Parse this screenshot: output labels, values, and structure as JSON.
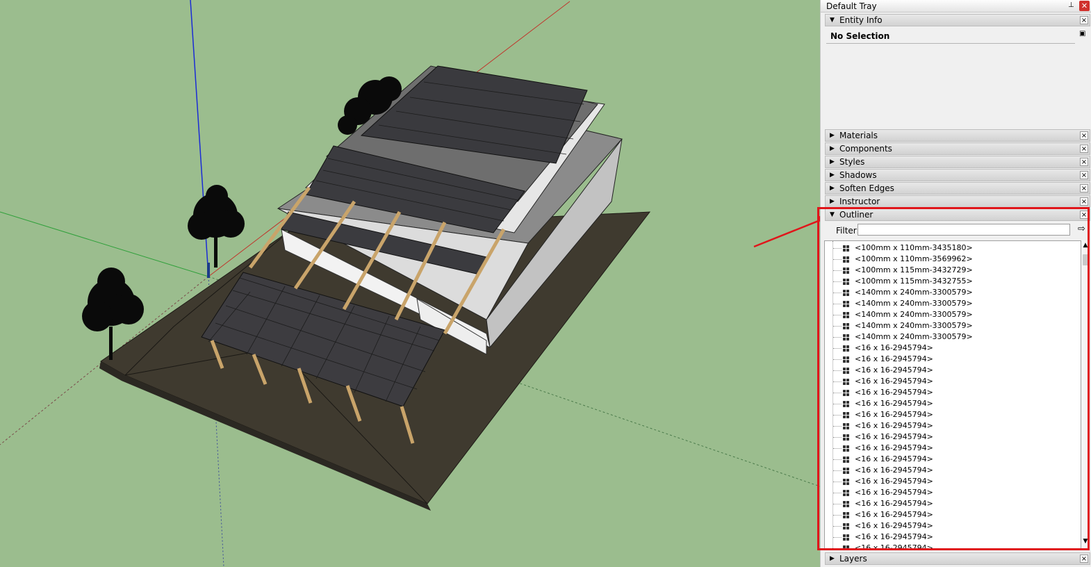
{
  "tray": {
    "title": "Default Tray",
    "close": "✕",
    "pin": "⊥"
  },
  "entity_info": {
    "label": "Entity Info",
    "status": "No Selection"
  },
  "panels": [
    {
      "label": "Materials"
    },
    {
      "label": "Components"
    },
    {
      "label": "Styles"
    },
    {
      "label": "Shadows"
    },
    {
      "label": "Soften Edges"
    },
    {
      "label": "Instructor"
    }
  ],
  "outliner": {
    "label": "Outliner",
    "filter_label": "Filter:",
    "filter_value": "",
    "items": [
      "<100mm x 110mm-3435180>",
      "<100mm x 110mm-3569962>",
      "<100mm x 115mm-3432729>",
      "<100mm x 115mm-3432755>",
      "<140mm x 240mm-3300579>",
      "<140mm x 240mm-3300579>",
      "<140mm x 240mm-3300579>",
      "<140mm x 240mm-3300579>",
      "<140mm x 240mm-3300579>",
      "<16 x 16-2945794>",
      "<16 x 16-2945794>",
      "<16 x 16-2945794>",
      "<16 x 16-2945794>",
      "<16 x 16-2945794>",
      "<16 x 16-2945794>",
      "<16 x 16-2945794>",
      "<16 x 16-2945794>",
      "<16 x 16-2945794>",
      "<16 x 16-2945794>",
      "<16 x 16-2945794>",
      "<16 x 16-2945794>",
      "<16 x 16-2945794>",
      "<16 x 16-2945794>",
      "<16 x 16-2945794>",
      "<16 x 16-2945794>",
      "<16 x 16-2945794>",
      "<16 x 16-2945794>",
      "<16 x 16-2945794>"
    ]
  },
  "layers": {
    "label": "Layers"
  },
  "colors": {
    "viewport_bg": "#9bbd8e",
    "highlight": "#e0161b",
    "axis_blue": "#1a2bd6",
    "axis_red": "#c0362c",
    "axis_green": "#2fa03a"
  }
}
